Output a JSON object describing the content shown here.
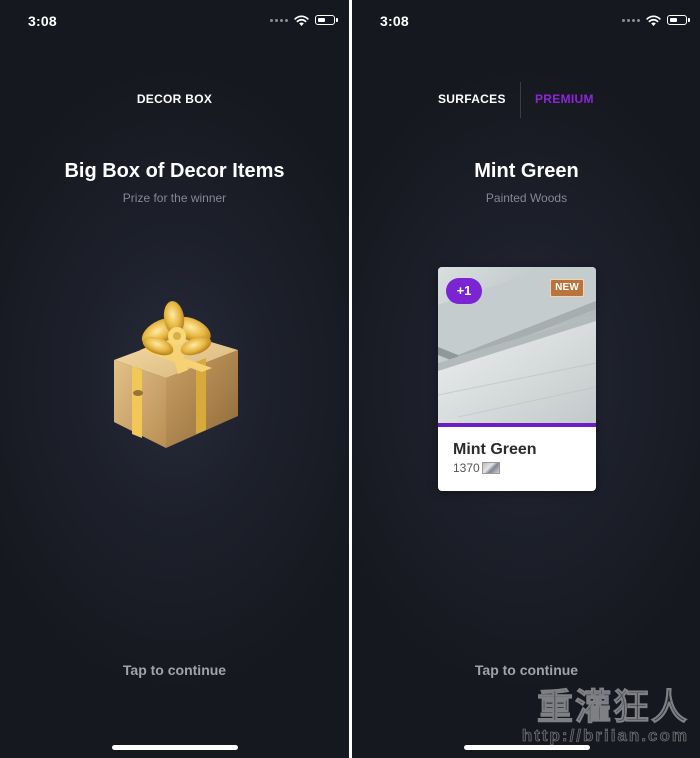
{
  "status_bar": {
    "time": "3:08"
  },
  "left_screen": {
    "header": "DECOR BOX",
    "title": "Big Box of Decor Items",
    "subtitle": "Prize for the winner",
    "footer": "Tap to continue"
  },
  "right_screen": {
    "tabs": [
      {
        "label": "SURFACES",
        "active": false
      },
      {
        "label": "PREMIUM",
        "active": true
      }
    ],
    "title": "Mint Green",
    "subtitle": "Painted Woods",
    "card": {
      "badge_count": "+1",
      "badge_new": "NEW",
      "name": "Mint Green",
      "price": "1370"
    },
    "footer": "Tap to continue"
  },
  "watermark": {
    "text": "重灌狂人",
    "url": "http://briian.com"
  },
  "colors": {
    "accent": "#8b27d6",
    "badge": "#7a24d3",
    "new_badge": "#b8743c",
    "background": "#1d202b"
  },
  "icons": [
    "wifi-icon",
    "battery-icon",
    "signal-icon",
    "gift-box-icon",
    "texture-swatch-icon"
  ]
}
